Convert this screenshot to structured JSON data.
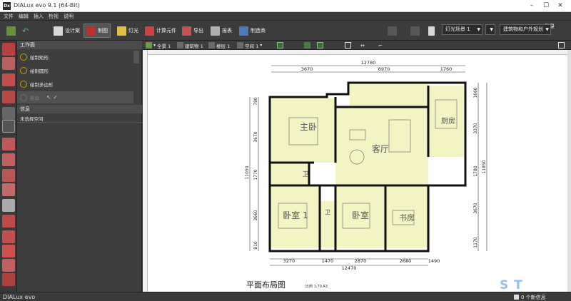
{
  "window": {
    "app_icon": "Dx",
    "title": "DIALux evo 9.1  (64-Bit)"
  },
  "menu": [
    "文件",
    "编辑",
    "插入",
    "检视",
    "说明"
  ],
  "toolbar": {
    "design": "设计案",
    "draw": "制图",
    "light": "灯光",
    "calc": "计算元件",
    "export": "导出",
    "report": "报表",
    "docs": "制造商",
    "login": "登录",
    "scene_combo": "灯光场景 1",
    "mode_combo": "建筑物和户外规划"
  },
  "panel": {
    "header": "工作面",
    "items": [
      "绘制矩形",
      "绘制圆形",
      "绘制多边形"
    ],
    "item4_label": "删除",
    "info_header": "信息",
    "info_text": "未选择空间"
  },
  "viewbar": {
    "all": "全景 1",
    "building": "建筑物 1",
    "floor": "楼层 1",
    "space": "空间 1"
  },
  "plan": {
    "dims_top_total": "12780",
    "dims_top": [
      "3670",
      "6970",
      "1760"
    ],
    "dims_bottom": [
      "3270",
      "1470",
      "2870",
      "2680",
      "1490"
    ],
    "dims_bottom_total": "12470",
    "dims_left": [
      "780",
      "3670",
      "1770",
      "3660",
      "810"
    ],
    "dim_left_total": "11050",
    "dims_right": [
      "1660",
      "3370",
      "1780",
      "3670",
      "1170"
    ],
    "dim_right_total": "11850",
    "rooms": {
      "master": "主卧",
      "living": "客厅",
      "kitchen": "厨房",
      "bath1": "卫",
      "bed1": "卧室 1",
      "bed2": "卧室",
      "study": "书房",
      "bath2": "卫"
    },
    "caption": "平面布局图",
    "scale": "比例  1:70  A3"
  },
  "status": {
    "brand": "DIALux evo",
    "message": "0 个新信息"
  },
  "watermark": "S   T",
  "colors": {
    "room_fill": "#f2f4c4",
    "wall": "#111111",
    "accent": "#c99a1a"
  }
}
